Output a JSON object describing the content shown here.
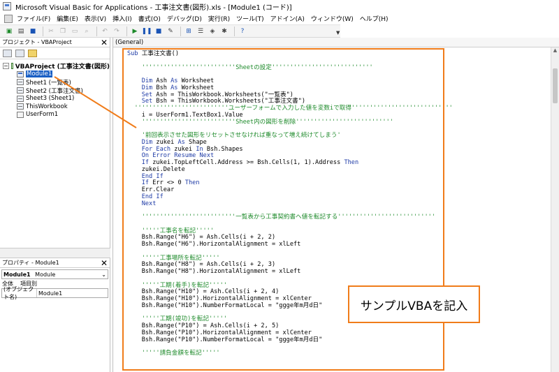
{
  "window": {
    "title": "Microsoft Visual Basic for Applications - 工事注文書(図形).xls - [Module1 (コード)]"
  },
  "menu": {
    "items": [
      "ファイル(F)",
      "編集(E)",
      "表示(V)",
      "挿入(I)",
      "書式(O)",
      "デバッグ(D)",
      "実行(R)",
      "ツール(T)",
      "アドイン(A)",
      "ウィンドウ(W)",
      "ヘルプ(H)"
    ]
  },
  "toolbar": {
    "icons": [
      "excel-icon",
      "insert-module-icon",
      "save-icon",
      "cut-icon",
      "copy-icon",
      "paste-icon",
      "find-icon",
      "undo-icon",
      "redo-icon",
      "run-icon",
      "break-icon",
      "reset-icon",
      "design-mode-icon",
      "project-explorer-icon",
      "properties-icon",
      "object-browser-icon",
      "toolbox-icon",
      "help-icon"
    ]
  },
  "project_pane": {
    "title": "プロジェクト - VBAProject",
    "tree": {
      "root": "VBAProject (工事注文書(図形)",
      "items": [
        "Module1",
        "Sheet1 (一覧表)",
        "Sheet2 (工事注文書)",
        "Sheet3 (Sheet1)",
        "ThisWorkbook",
        "UserForm1"
      ]
    }
  },
  "properties_pane": {
    "title": "プロパティ - Module1",
    "object_name": "Module1",
    "object_type": "Module",
    "tabs": [
      "全体",
      "項目別"
    ],
    "row": {
      "key": "(オブジェクト名)",
      "value": "Module1"
    }
  },
  "code_window": {
    "object_selector": "(General)",
    "lines": [
      {
        "segments": [
          {
            "t": "kw",
            "v": "Sub"
          },
          {
            "t": "tx",
            "v": " 工事注文書()"
          }
        ]
      },
      {
        "segments": []
      },
      {
        "segments": [
          {
            "t": "cm",
            "v": "    ''''''''''''''''''''''''''Sheetの設定''''''''''''''''''''''''''''"
          }
        ]
      },
      {
        "segments": []
      },
      {
        "segments": [
          {
            "t": "kw",
            "v": "    Dim"
          },
          {
            "t": "tx",
            "v": " Ash "
          },
          {
            "t": "kw",
            "v": "As"
          },
          {
            "t": "tx",
            "v": " Worksheet"
          }
        ]
      },
      {
        "segments": [
          {
            "t": "kw",
            "v": "    Dim"
          },
          {
            "t": "tx",
            "v": " Bsh "
          },
          {
            "t": "kw",
            "v": "As"
          },
          {
            "t": "tx",
            "v": " Worksheet"
          }
        ]
      },
      {
        "segments": [
          {
            "t": "kw",
            "v": "    Set"
          },
          {
            "t": "tx",
            "v": " Ash = ThisWorkbook.Worksheets(\"一覧表\")"
          }
        ]
      },
      {
        "segments": [
          {
            "t": "kw",
            "v": "    Set"
          },
          {
            "t": "tx",
            "v": " Bsh = ThisWorkbook.Worksheets(\"工事注文書\")"
          }
        ]
      },
      {
        "segments": [
          {
            "t": "cm",
            "v": "  ''''''''''''''''''''''''''ユーザーフォームで入力した値を変数iで取得''''''''''''''''''''''''''''"
          }
        ]
      },
      {
        "segments": [
          {
            "t": "tx",
            "v": "    i = UserForm1.TextBox1.Value"
          }
        ]
      },
      {
        "segments": [
          {
            "t": "cm",
            "v": "    ''''''''''''''''''''''''''Sheet内の図形を削除'''''''''''''''''''''''''''"
          }
        ]
      },
      {
        "segments": []
      },
      {
        "segments": [
          {
            "t": "cm",
            "v": "    '前回表示させた図形をリセットさせなければ重なって増え続けてしまう'"
          }
        ]
      },
      {
        "segments": [
          {
            "t": "kw",
            "v": "    Dim"
          },
          {
            "t": "tx",
            "v": " zukei "
          },
          {
            "t": "kw",
            "v": "As"
          },
          {
            "t": "tx",
            "v": " Shape"
          }
        ]
      },
      {
        "segments": [
          {
            "t": "kw",
            "v": "    For Each"
          },
          {
            "t": "tx",
            "v": " zukei "
          },
          {
            "t": "kw",
            "v": "In"
          },
          {
            "t": "tx",
            "v": " Bsh.Shapes"
          }
        ]
      },
      {
        "segments": [
          {
            "t": "kw",
            "v": "    On Error Resume Next"
          }
        ]
      },
      {
        "segments": [
          {
            "t": "kw",
            "v": "    If"
          },
          {
            "t": "tx",
            "v": " zukei.TopLeftCell.Address >= Bsh.Cells(1, 1).Address "
          },
          {
            "t": "kw",
            "v": "Then"
          }
        ]
      },
      {
        "segments": [
          {
            "t": "tx",
            "v": "    zukei.Delete"
          }
        ]
      },
      {
        "segments": [
          {
            "t": "kw",
            "v": "    End If"
          }
        ]
      },
      {
        "segments": [
          {
            "t": "kw",
            "v": "    If"
          },
          {
            "t": "tx",
            "v": " Err <> 0 "
          },
          {
            "t": "kw",
            "v": "Then"
          }
        ]
      },
      {
        "segments": [
          {
            "t": "tx",
            "v": "    Err.Clear"
          }
        ]
      },
      {
        "segments": [
          {
            "t": "kw",
            "v": "    End If"
          }
        ]
      },
      {
        "segments": [
          {
            "t": "kw",
            "v": "    Next"
          }
        ]
      },
      {
        "segments": []
      },
      {
        "segments": [
          {
            "t": "cm",
            "v": "    ''''''''''''''''''''''''''一覧表から工事契約書へ値を転記する'''''''''''''''''''''''''''"
          }
        ]
      },
      {
        "segments": []
      },
      {
        "segments": [
          {
            "t": "cm",
            "v": "    '''''工事名を転記'''''"
          }
        ]
      },
      {
        "segments": [
          {
            "t": "tx",
            "v": "    Bsh.Range(\"H6\") = Ash.Cells(i + 2, 2)"
          }
        ]
      },
      {
        "segments": [
          {
            "t": "tx",
            "v": "    Bsh.Range(\"H6\").HorizontalAlignment = xlLeft"
          }
        ]
      },
      {
        "segments": []
      },
      {
        "segments": [
          {
            "t": "cm",
            "v": "    '''''工事場所を転記'''''"
          }
        ]
      },
      {
        "segments": [
          {
            "t": "tx",
            "v": "    Bsh.Range(\"H8\") = Ash.Cells(i + 2, 3)"
          }
        ]
      },
      {
        "segments": [
          {
            "t": "tx",
            "v": "    Bsh.Range(\"H8\").HorizontalAlignment = xlLeft"
          }
        ]
      },
      {
        "segments": []
      },
      {
        "segments": [
          {
            "t": "cm",
            "v": "    '''''工期(着手)を転記'''''"
          }
        ]
      },
      {
        "segments": [
          {
            "t": "tx",
            "v": "    Bsh.Range(\"H10\") = Ash.Cells(i + 2, 4)"
          }
        ]
      },
      {
        "segments": [
          {
            "t": "tx",
            "v": "    Bsh.Range(\"H10\").HorizontalAlignment = xlCenter"
          }
        ]
      },
      {
        "segments": [
          {
            "t": "tx",
            "v": "    Bsh.Range(\"H10\").NumberFormatLocal = \"ggge年m月d日\""
          }
        ]
      },
      {
        "segments": []
      },
      {
        "segments": [
          {
            "t": "cm",
            "v": "    '''''工期(竣功)を転記'''''"
          }
        ]
      },
      {
        "segments": [
          {
            "t": "tx",
            "v": "    Bsh.Range(\"P10\") = Ash.Cells(i + 2, 5)"
          }
        ]
      },
      {
        "segments": [
          {
            "t": "tx",
            "v": "    Bsh.Range(\"P10\").HorizontalAlignment = xlCenter"
          }
        ]
      },
      {
        "segments": [
          {
            "t": "tx",
            "v": "    Bsh.Range(\"P10\").NumberFormatLocal = \"ggge年m月d日\""
          }
        ]
      },
      {
        "segments": []
      },
      {
        "segments": [
          {
            "t": "cm",
            "v": "    '''''請負金額を転記'''''"
          }
        ]
      }
    ]
  },
  "annotation": {
    "callout_text": "サンプルVBAを記入",
    "color": "#f07c1a"
  }
}
